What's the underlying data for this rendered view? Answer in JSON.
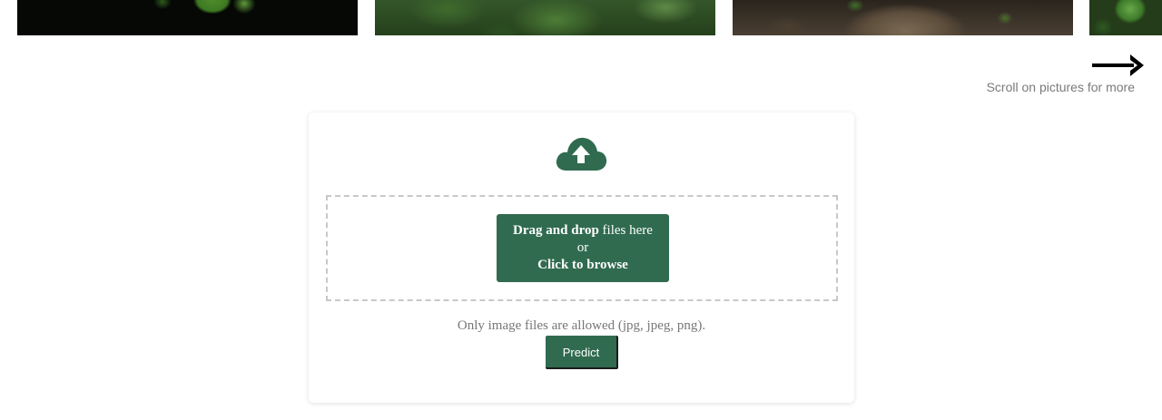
{
  "gallery": {
    "images": [
      {
        "alt": ""
      },
      {
        "alt": ""
      },
      {
        "alt": ""
      },
      {
        "alt": ""
      }
    ]
  },
  "scroll_hint": {
    "text": "Scroll on pictures for more",
    "icon": "arrow-right-icon"
  },
  "upload": {
    "icon": "cloud-upload-icon",
    "drag_bold": "Drag and drop",
    "drag_rest": " files here",
    "or": "or",
    "click": "Click to browse",
    "allowed": "Only image files are allowed (jpg, jpeg, png).",
    "predict": "Predict"
  },
  "colors": {
    "accent": "#306b4f",
    "muted_text": "#777777"
  }
}
